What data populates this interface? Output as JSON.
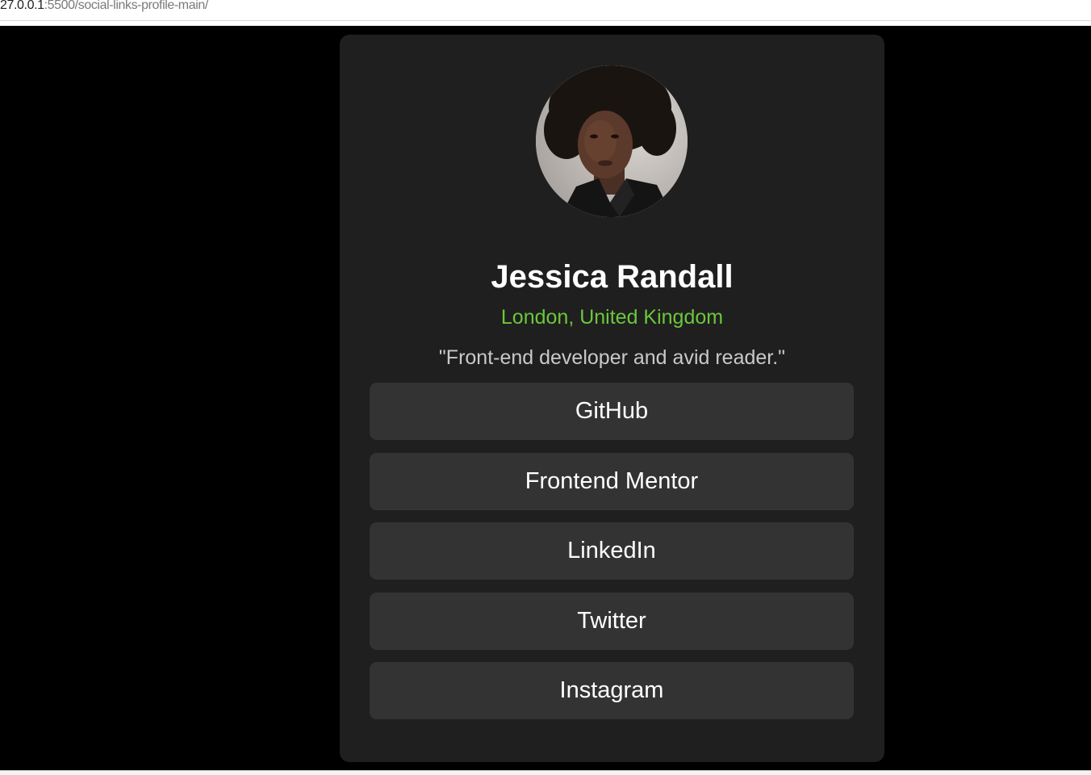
{
  "browser": {
    "url_host": "27.0.0.1",
    "url_path": ":5500/social-links-profile-main/"
  },
  "profile": {
    "avatar_icon": "profile-photo",
    "name": "Jessica Randall",
    "location": "London, United Kingdom",
    "bio": "\"Front-end developer and avid reader.\"",
    "links": [
      {
        "label": "GitHub"
      },
      {
        "label": "Frontend Mentor"
      },
      {
        "label": "LinkedIn"
      },
      {
        "label": "Twitter"
      },
      {
        "label": "Instagram"
      }
    ]
  },
  "colors": {
    "page_background": "#000000",
    "card_background": "#1f1f1f",
    "link_background": "#333333",
    "accent_green": "#6cc73b",
    "text_white": "#ffffff",
    "text_grey": "#c9c9c9"
  }
}
